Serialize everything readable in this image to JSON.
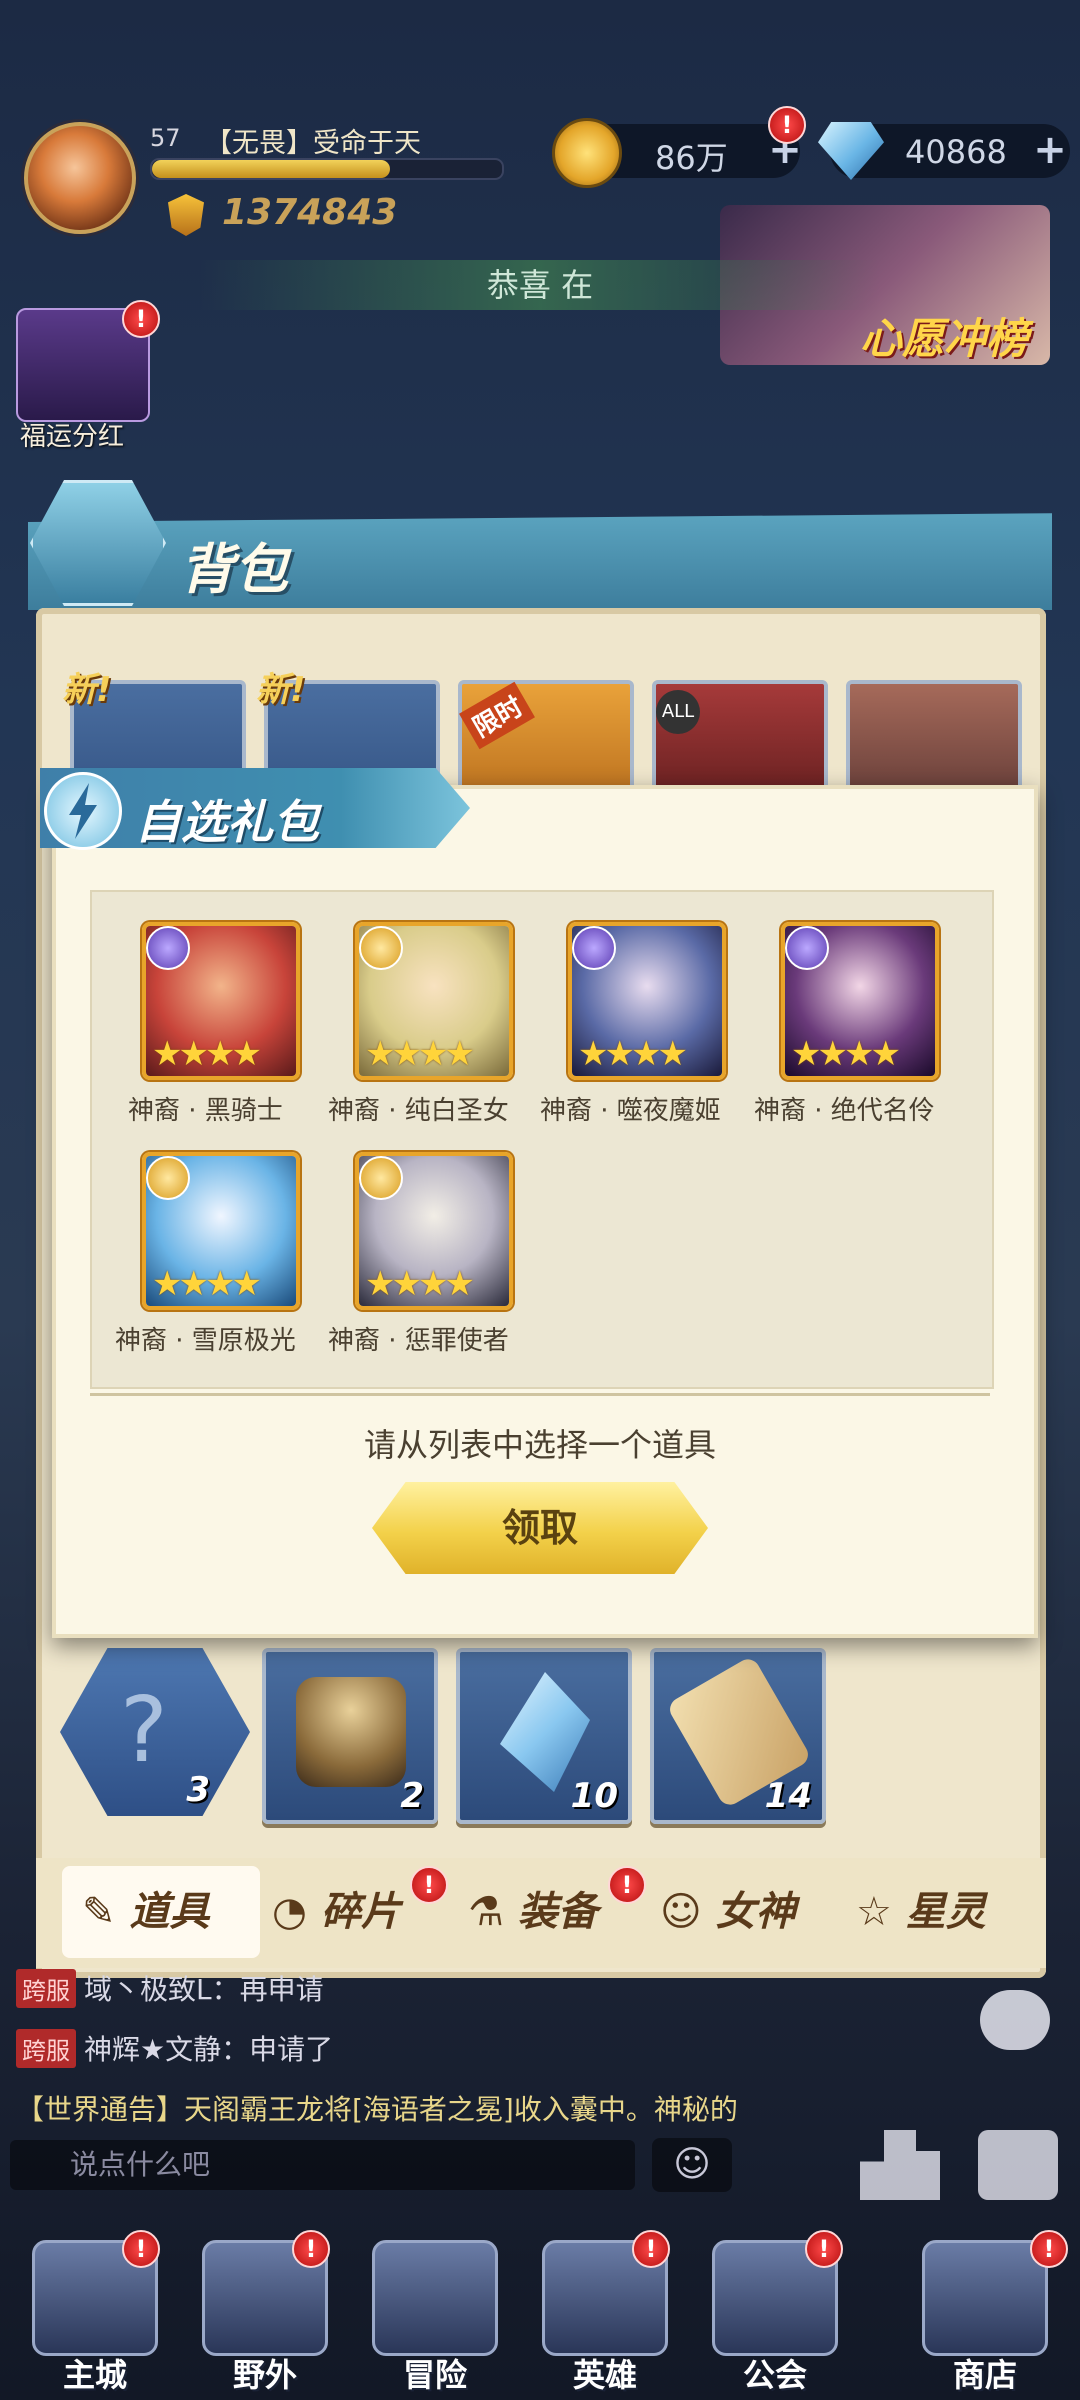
{
  "hud": {
    "level": "57",
    "player_name": "【无畏】受命于天",
    "xp_progress": 0.68,
    "power": "1374843",
    "gold": "86万",
    "gems": "40868",
    "plus": "+",
    "badge": "!"
  },
  "marquee": {
    "text": "恭喜          在"
  },
  "wish_banner": {
    "text": "心愿冲榜"
  },
  "fortune": {
    "label": "福运分红"
  },
  "bag": {
    "title": "背包",
    "new_label": "新!",
    "limited_label": "限时",
    "all_label": "ALL",
    "items": [
      {
        "icon": "question-scroll-icon",
        "count": "3"
      },
      {
        "icon": "treasure-altar-icon",
        "count": "2"
      },
      {
        "icon": "crystal-shard-icon",
        "count": "10"
      },
      {
        "icon": "scroll-icon",
        "count": "14"
      }
    ],
    "tabs": [
      {
        "label": "道具",
        "icon": "items-icon"
      },
      {
        "label": "碎片",
        "icon": "fragment-icon"
      },
      {
        "label": "装备",
        "icon": "equipment-icon"
      },
      {
        "label": "女神",
        "icon": "goddess-icon"
      },
      {
        "label": "星灵",
        "icon": "star-spirit-icon"
      }
    ]
  },
  "dialog": {
    "title": "自选礼包",
    "heroes": [
      {
        "name": "神裔 · 黑骑士",
        "stars": "★★★★",
        "color": "#c8443a"
      },
      {
        "name": "神裔 · 纯白圣女",
        "stars": "★★★★",
        "color": "#d9cc8a"
      },
      {
        "name": "神裔 · 噬夜魔姬",
        "stars": "★★★★",
        "color": "#5a6aa6"
      },
      {
        "name": "神裔 · 绝代名伶",
        "stars": "★★★★",
        "color": "#6a3a7a"
      },
      {
        "name": "神裔 · 雪原极光",
        "stars": "★★★★",
        "color": "#6ab4e6"
      },
      {
        "name": "神裔 · 惩罪使者",
        "stars": "★★★★",
        "color": "#b8b4c4"
      }
    ],
    "prompt": "请从列表中选择一个道具",
    "claim_label": "领取"
  },
  "chat": {
    "cross_label": "跨服",
    "lines": [
      {
        "text": "域丶极致L：再申请"
      },
      {
        "text": "神辉★文静：申请了"
      }
    ],
    "world_notice": "【世界通告】天阁霸王龙将[海语者之冕]收入囊中。神秘的",
    "input_placeholder": "说点什么吧",
    "emoji": "☺"
  },
  "nav": [
    {
      "label": "主城",
      "icon": "city-icon"
    },
    {
      "label": "野外",
      "icon": "wild-icon"
    },
    {
      "label": "冒险",
      "icon": "adventure-icon"
    },
    {
      "label": "英雄",
      "icon": "hero-helmet-icon"
    },
    {
      "label": "公会",
      "icon": "guild-icon"
    },
    {
      "label": "商店",
      "icon": "shop-icon"
    }
  ],
  "colors": {
    "accent_gold": "#f3d14a",
    "panel_blue": "#3f7fa9",
    "badge_red": "#d81e1e"
  }
}
